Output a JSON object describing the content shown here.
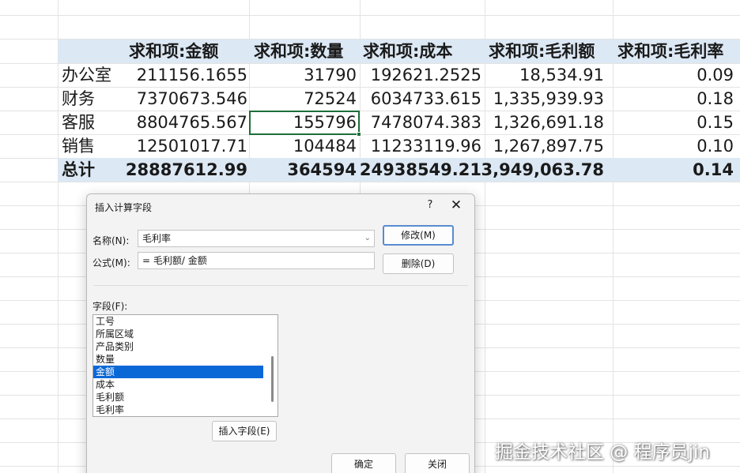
{
  "pivot": {
    "headers": [
      "求和项:金额",
      "求和项:数量",
      "求和项:成本",
      "求和项:毛利额",
      "求和项:毛利率"
    ],
    "rows": [
      {
        "label": "办公室",
        "values": [
          "211156.1655",
          "31790",
          "192621.2525",
          "18,534.91",
          "0.09"
        ]
      },
      {
        "label": "财务",
        "values": [
          "7370673.546",
          "72524",
          "6034733.615",
          "1,335,939.93",
          "0.18"
        ]
      },
      {
        "label": "客服",
        "values": [
          "8804765.567",
          "155796",
          "7478074.383",
          "1,326,691.18",
          "0.15"
        ]
      },
      {
        "label": "销售",
        "values": [
          "12501017.71",
          "104484",
          "11233119.96",
          "1,267,897.75",
          "0.10"
        ]
      }
    ],
    "total": {
      "label": "总计",
      "values": [
        "28887612.99",
        "364594",
        "24938549.21",
        "3,949,063.78",
        "0.14"
      ]
    }
  },
  "dialog": {
    "title": "插入计算字段",
    "help_label": "?",
    "close_label": "✕",
    "name_label": "名称(N):",
    "name_value": "毛利率",
    "formula_label": "公式(M):",
    "formula_value": "= 毛利额/ 金额",
    "modify_button": "修改(M)",
    "delete_button": "删除(D)",
    "fields_label": "字段(F):",
    "fields": [
      "工号",
      "所属区域",
      "产品类别",
      "数量",
      "金额",
      "成本",
      "毛利额",
      "毛利率"
    ],
    "selected_field": "金额",
    "insert_field_button": "插入字段(E)",
    "ok_button": "确定",
    "close_button": "关闭"
  },
  "watermark": "掘金技术社区 @ 程序员jin"
}
